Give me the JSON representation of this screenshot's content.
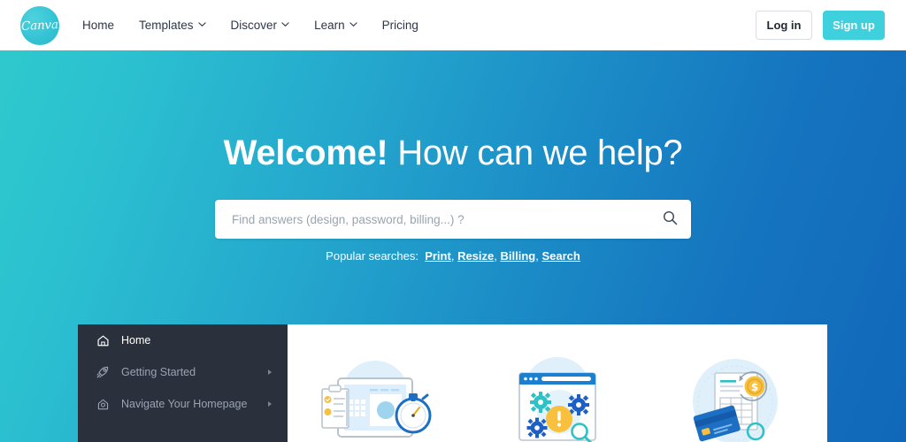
{
  "brand": {
    "logo_text": "Canva",
    "logo_color": "#33c2d4"
  },
  "topbar": {
    "nav_items": [
      {
        "label": "Home",
        "has_caret": false
      },
      {
        "label": "Templates",
        "has_caret": true
      },
      {
        "label": "Discover",
        "has_caret": true
      },
      {
        "label": "Learn",
        "has_caret": true
      },
      {
        "label": "Pricing",
        "has_caret": false
      }
    ],
    "login_label": "Log in",
    "signup_label": "Sign up",
    "signup_color": "#3ed0dd"
  },
  "hero": {
    "title_bold": "Welcome!",
    "title_rest": "How can we help?",
    "gradient_from": "#2ec9cd",
    "gradient_to": "#1168b9",
    "search": {
      "placeholder": "Find answers (design, password, billing...) ?",
      "value": "",
      "icon": "search-icon"
    },
    "popular": {
      "label": "Popular searches:",
      "links": [
        "Print",
        "Resize",
        "Billing",
        "Search"
      ],
      "separator": ", "
    }
  },
  "panel": {
    "sidebar": {
      "background": "#2a313d",
      "items": [
        {
          "label": "Home",
          "icon": "house-icon",
          "active": true,
          "has_arrow": false
        },
        {
          "label": "Getting Started",
          "icon": "rocket-icon",
          "active": false,
          "has_arrow": true
        },
        {
          "label": "Navigate Your Homepage",
          "icon": "house-circle-icon",
          "active": false,
          "has_arrow": true
        }
      ]
    },
    "cards": [
      {
        "illustration": "tablet-clipboard-stopwatch-illustration"
      },
      {
        "illustration": "browser-gears-warning-illustration"
      },
      {
        "illustration": "invoice-creditcard-coin-illustration"
      }
    ]
  }
}
